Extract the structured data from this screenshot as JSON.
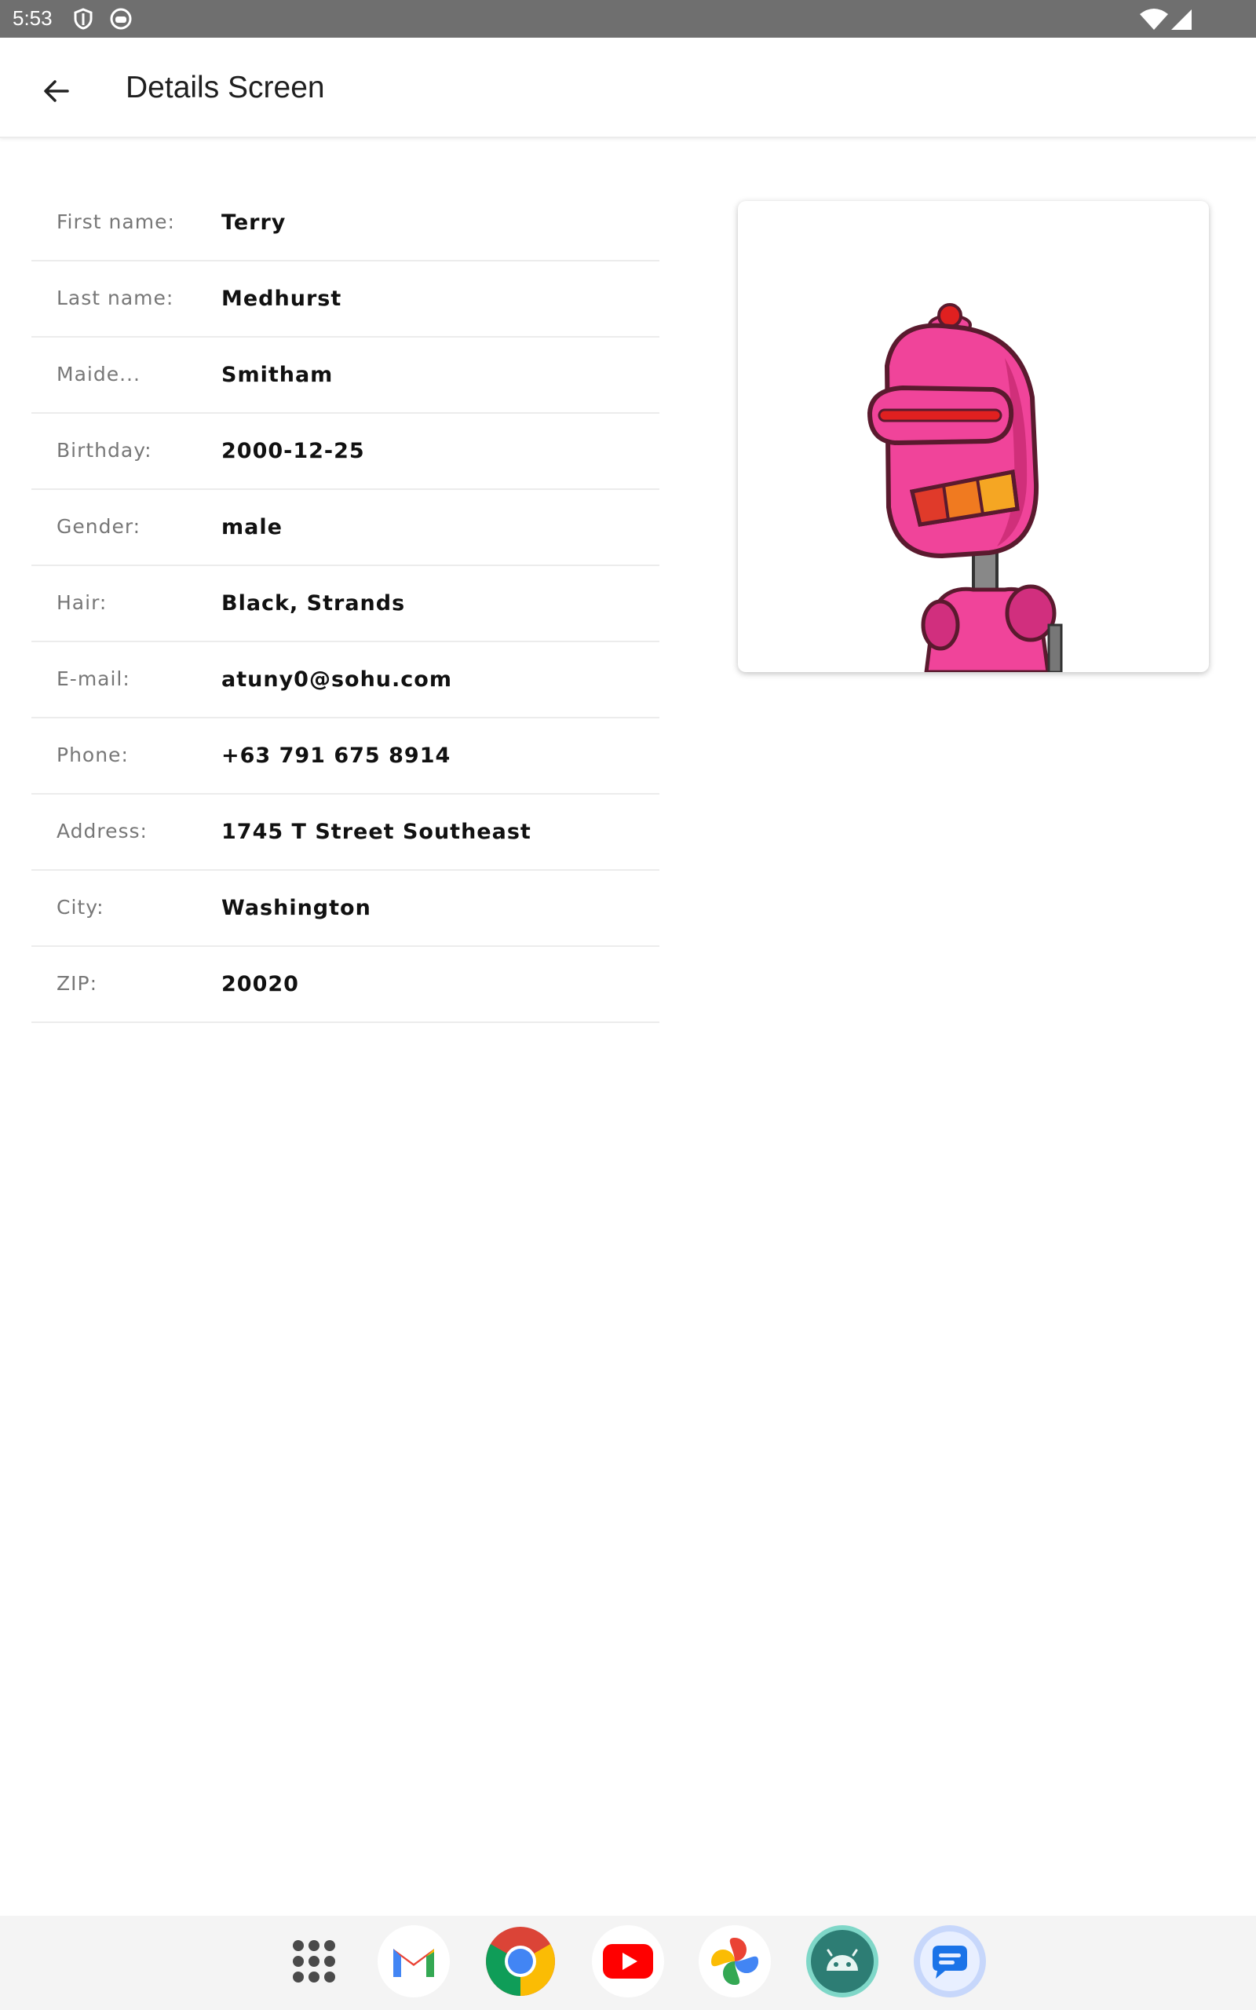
{
  "status_bar": {
    "time": "5:53",
    "icons": [
      "shield-icon",
      "face-icon",
      "wifi-icon",
      "cell-signal-icon"
    ],
    "background": "#6f6f6f"
  },
  "app_bar": {
    "title": "Details Screen",
    "back_icon": "arrow-back-icon"
  },
  "details": [
    {
      "label": "First name:",
      "value": "Terry"
    },
    {
      "label": "Last name:",
      "value": "Medhurst"
    },
    {
      "label": "Maide...",
      "value": "Smitham"
    },
    {
      "label": "Birthday:",
      "value": "2000-12-25"
    },
    {
      "label": "Gender:",
      "value": "male"
    },
    {
      "label": "Hair:",
      "value": "Black, Strands"
    },
    {
      "label": "E-mail:",
      "value": "atuny0@sohu.com"
    },
    {
      "label": "Phone:",
      "value": "+63 791 675 8914"
    },
    {
      "label": "Address:",
      "value": "1745 T Street Southeast"
    },
    {
      "label": "City:",
      "value": "Washington"
    },
    {
      "label": "ZIP:",
      "value": "20020"
    }
  ],
  "avatar": {
    "icon": "pink-robot-avatar",
    "colors": {
      "body": "#f0449a",
      "visor": "#e8207a",
      "light": "#e02020",
      "teeth": [
        "#e03a2a",
        "#f07a20",
        "#f5a623"
      ]
    }
  },
  "dock": {
    "apps": [
      "app-drawer-icon",
      "gmail-icon",
      "chrome-icon",
      "youtube-icon",
      "photos-icon",
      "android-studio-icon",
      "messages-icon"
    ]
  }
}
